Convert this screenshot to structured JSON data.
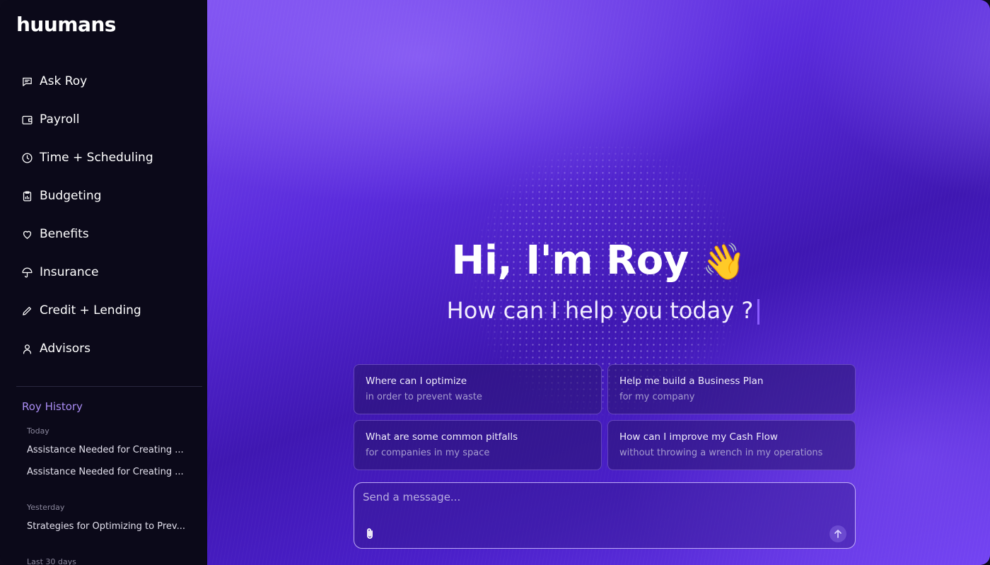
{
  "app": {
    "logo": "huumans"
  },
  "sidebar": {
    "items": [
      {
        "label": "Ask Roy",
        "icon": "chat-icon"
      },
      {
        "label": "Payroll",
        "icon": "wallet-icon"
      },
      {
        "label": "Time + Scheduling",
        "icon": "clock-icon"
      },
      {
        "label": "Budgeting",
        "icon": "clipboard-chart-icon"
      },
      {
        "label": "Benefits",
        "icon": "heart-icon"
      },
      {
        "label": "Insurance",
        "icon": "umbrella-icon"
      },
      {
        "label": "Credit + Lending",
        "icon": "pencil-icon"
      },
      {
        "label": "Advisors",
        "icon": "person-icon"
      }
    ],
    "history": {
      "title": "Roy History",
      "groups": [
        {
          "label": "Today",
          "items": [
            "Assistance Needed for Creating ...",
            "Assistance Needed for Creating ..."
          ]
        },
        {
          "label": "Yesterday",
          "items": [
            "Strategies for Optimizing to Prev..."
          ]
        },
        {
          "label": "Last 30 days",
          "items": []
        }
      ]
    }
  },
  "main": {
    "greeting": "Hi, I'm Roy",
    "greeting_emoji": "👋",
    "subtitle": "How can I help you today ?",
    "suggestions": [
      {
        "title": "Where can I optimize",
        "subtitle": "in order to prevent waste"
      },
      {
        "title": "Help me build a Business Plan",
        "subtitle": "for my company"
      },
      {
        "title": "What are some common pitfalls",
        "subtitle": "for companies in my space"
      },
      {
        "title": "How can I improve my Cash Flow",
        "subtitle": "without throwing a wrench in my operations"
      }
    ],
    "composer": {
      "placeholder": "Send a message...",
      "value": ""
    }
  },
  "colors": {
    "sidebar_bg": "#0b0919",
    "accent": "#a98cf2",
    "main_purple": "#5a2bdc"
  }
}
